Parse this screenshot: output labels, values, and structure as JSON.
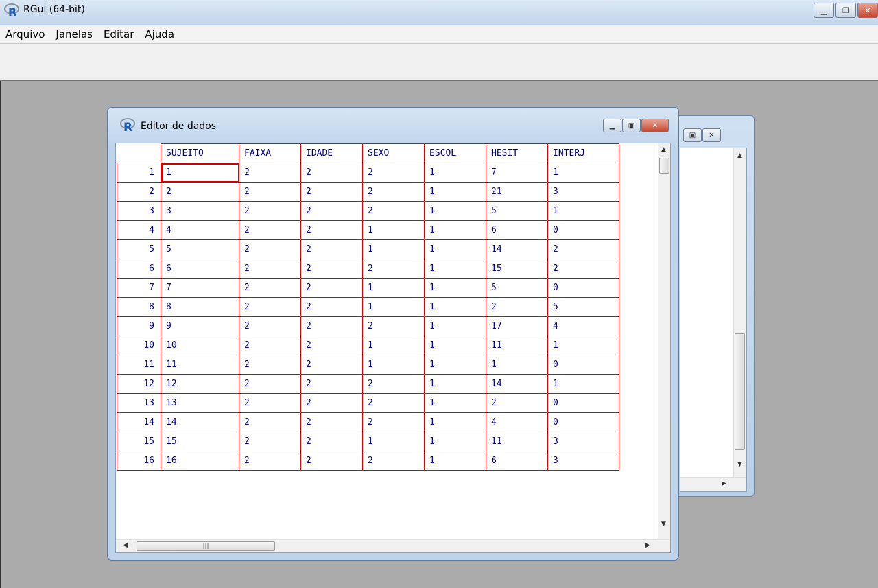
{
  "app": {
    "title": "RGui (64-bit)",
    "menu": [
      "Arquivo",
      "Janelas",
      "Editar",
      "Ajuda"
    ]
  },
  "editor": {
    "title": "Editor de dados",
    "columns": [
      "SUJEITO",
      "FAIXA",
      "IDADE",
      "SEXO",
      "ESCOL",
      "HESIT",
      "INTERJ"
    ],
    "rows": [
      [
        "1",
        "1",
        "2",
        "2",
        "2",
        "1",
        "7",
        "1"
      ],
      [
        "2",
        "2",
        "2",
        "2",
        "2",
        "1",
        "21",
        "3"
      ],
      [
        "3",
        "3",
        "2",
        "2",
        "2",
        "1",
        "5",
        "1"
      ],
      [
        "4",
        "4",
        "2",
        "2",
        "1",
        "1",
        "6",
        "0"
      ],
      [
        "5",
        "5",
        "2",
        "2",
        "1",
        "1",
        "14",
        "2"
      ],
      [
        "6",
        "6",
        "2",
        "2",
        "2",
        "1",
        "15",
        "2"
      ],
      [
        "7",
        "7",
        "2",
        "2",
        "1",
        "1",
        "5",
        "0"
      ],
      [
        "8",
        "8",
        "2",
        "2",
        "1",
        "1",
        "2",
        "5"
      ],
      [
        "9",
        "9",
        "2",
        "2",
        "2",
        "1",
        "17",
        "4"
      ],
      [
        "10",
        "10",
        "2",
        "2",
        "1",
        "1",
        "11",
        "1"
      ],
      [
        "11",
        "11",
        "2",
        "2",
        "1",
        "1",
        "1",
        "0"
      ],
      [
        "12",
        "12",
        "2",
        "2",
        "2",
        "1",
        "14",
        "1"
      ],
      [
        "13",
        "13",
        "2",
        "2",
        "2",
        "1",
        "2",
        "0"
      ],
      [
        "14",
        "14",
        "2",
        "2",
        "2",
        "1",
        "4",
        "0"
      ],
      [
        "15",
        "15",
        "2",
        "2",
        "1",
        "1",
        "11",
        "3"
      ],
      [
        "16",
        "16",
        "2",
        "2",
        "2",
        "1",
        "6",
        "3"
      ]
    ],
    "selected_cell": {
      "row": 1,
      "column": "SUJEITO"
    }
  },
  "icons": {
    "app": "r-logo-icon",
    "minimize": "minimize-icon",
    "maximize": "maximize-icon",
    "restore": "restore-icon",
    "close": "close-icon"
  },
  "colors": {
    "grid_lines": "#e00000",
    "cell_text": "#00008b",
    "desktop": "#ababab"
  }
}
